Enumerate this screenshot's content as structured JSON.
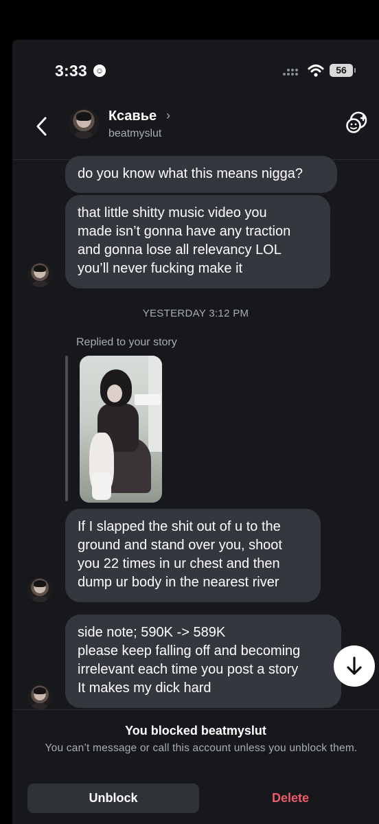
{
  "status_bar": {
    "time": "3:33",
    "battery": "56"
  },
  "header": {
    "name": "Ксавье",
    "handle": "beatmyslut",
    "chevron": "›"
  },
  "messages": [
    {
      "lines": [
        "do you know what this means nigga?"
      ]
    },
    {
      "lines": [
        "that little shitty music video you",
        "made isn’t gonna have any traction",
        "and gonna lose all relevancy LOL",
        "you’ll never fucking make it"
      ]
    },
    {
      "lines": [
        "If I slapped the shit out of u to the",
        "ground and stand over you, shoot",
        "you 22 times in ur chest and then",
        "dump ur body in the nearest river"
      ]
    },
    {
      "lines": [
        "side note; 590K -> 589K",
        "please keep falling off and becoming",
        "irrelevant each time you post a story",
        "It makes my dick hard"
      ]
    }
  ],
  "timestamp": "YESTERDAY 3:12 PM",
  "reply_label": "Replied to your story",
  "blocked": {
    "title": "You blocked beatmyslut",
    "subtitle": "You can’t message or call this account unless you unblock them."
  },
  "actions": {
    "unblock": "Unblock",
    "delete": "Delete"
  },
  "icons": {
    "back": "chevron-left-icon",
    "add_people": "add-people-icon",
    "scroll_down": "arrow-down-icon"
  }
}
